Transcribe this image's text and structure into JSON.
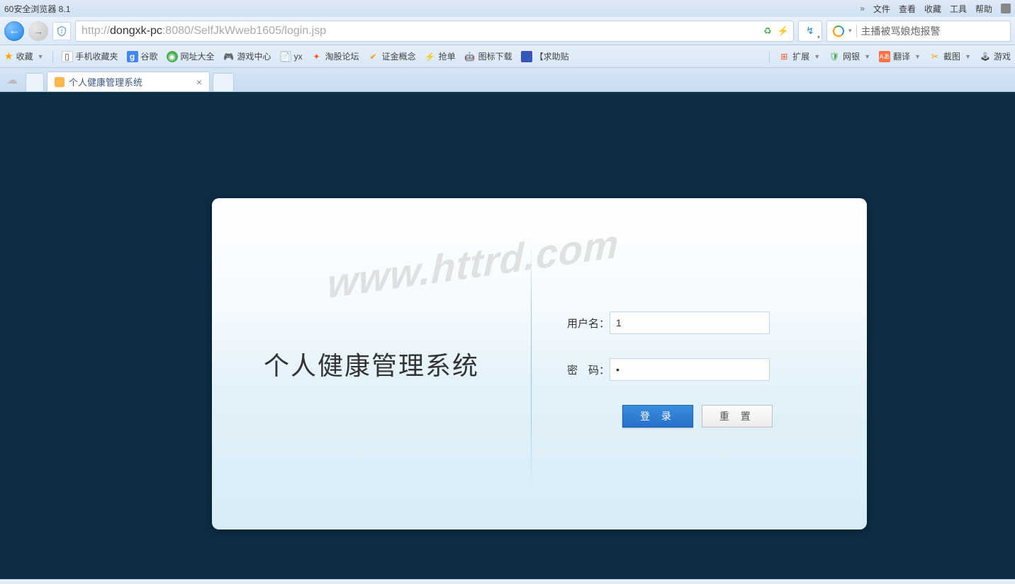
{
  "browser": {
    "title": "60安全浏览器 8.1",
    "menu": [
      "文件",
      "查看",
      "收藏",
      "工具",
      "帮助"
    ],
    "url_prefix": "http://",
    "url_host": "dongxk-pc",
    "url_rest": ":8080/SelfJkWweb1605/login.jsp",
    "search_placeholder": "主播被骂娘炮报警"
  },
  "bookmarks_left": [
    {
      "label": "收藏",
      "icon": "star"
    },
    {
      "label": "手机收藏夹",
      "icon": "phone"
    },
    {
      "label": "谷歌",
      "icon": "g"
    },
    {
      "label": "网址大全",
      "icon": "compass"
    },
    {
      "label": "游戏中心",
      "icon": "game"
    },
    {
      "label": "yx",
      "icon": "doc"
    },
    {
      "label": "淘股论坛",
      "icon": "spark"
    },
    {
      "label": "证金概念",
      "icon": "swoosh"
    },
    {
      "label": "抢单",
      "icon": "bolt"
    },
    {
      "label": "图标下载",
      "icon": "robot"
    },
    {
      "label": "【求助贴",
      "icon": "paw"
    }
  ],
  "bookmarks_right": [
    {
      "label": "扩展",
      "icon": "grid"
    },
    {
      "label": "网银",
      "icon": "shield"
    },
    {
      "label": "翻译",
      "icon": "az"
    },
    {
      "label": "截图",
      "icon": "scissors"
    },
    {
      "label": "游戏",
      "icon": "joystick"
    }
  ],
  "tab": {
    "title": "个人健康管理系统"
  },
  "login": {
    "system_title": "个人健康管理系统",
    "username_label": "用户名：",
    "password_label": "密　码：",
    "username_value": "1",
    "password_value": "•",
    "login_btn": "登 录",
    "reset_btn": "重 置"
  },
  "watermark": "www.httrd.com"
}
